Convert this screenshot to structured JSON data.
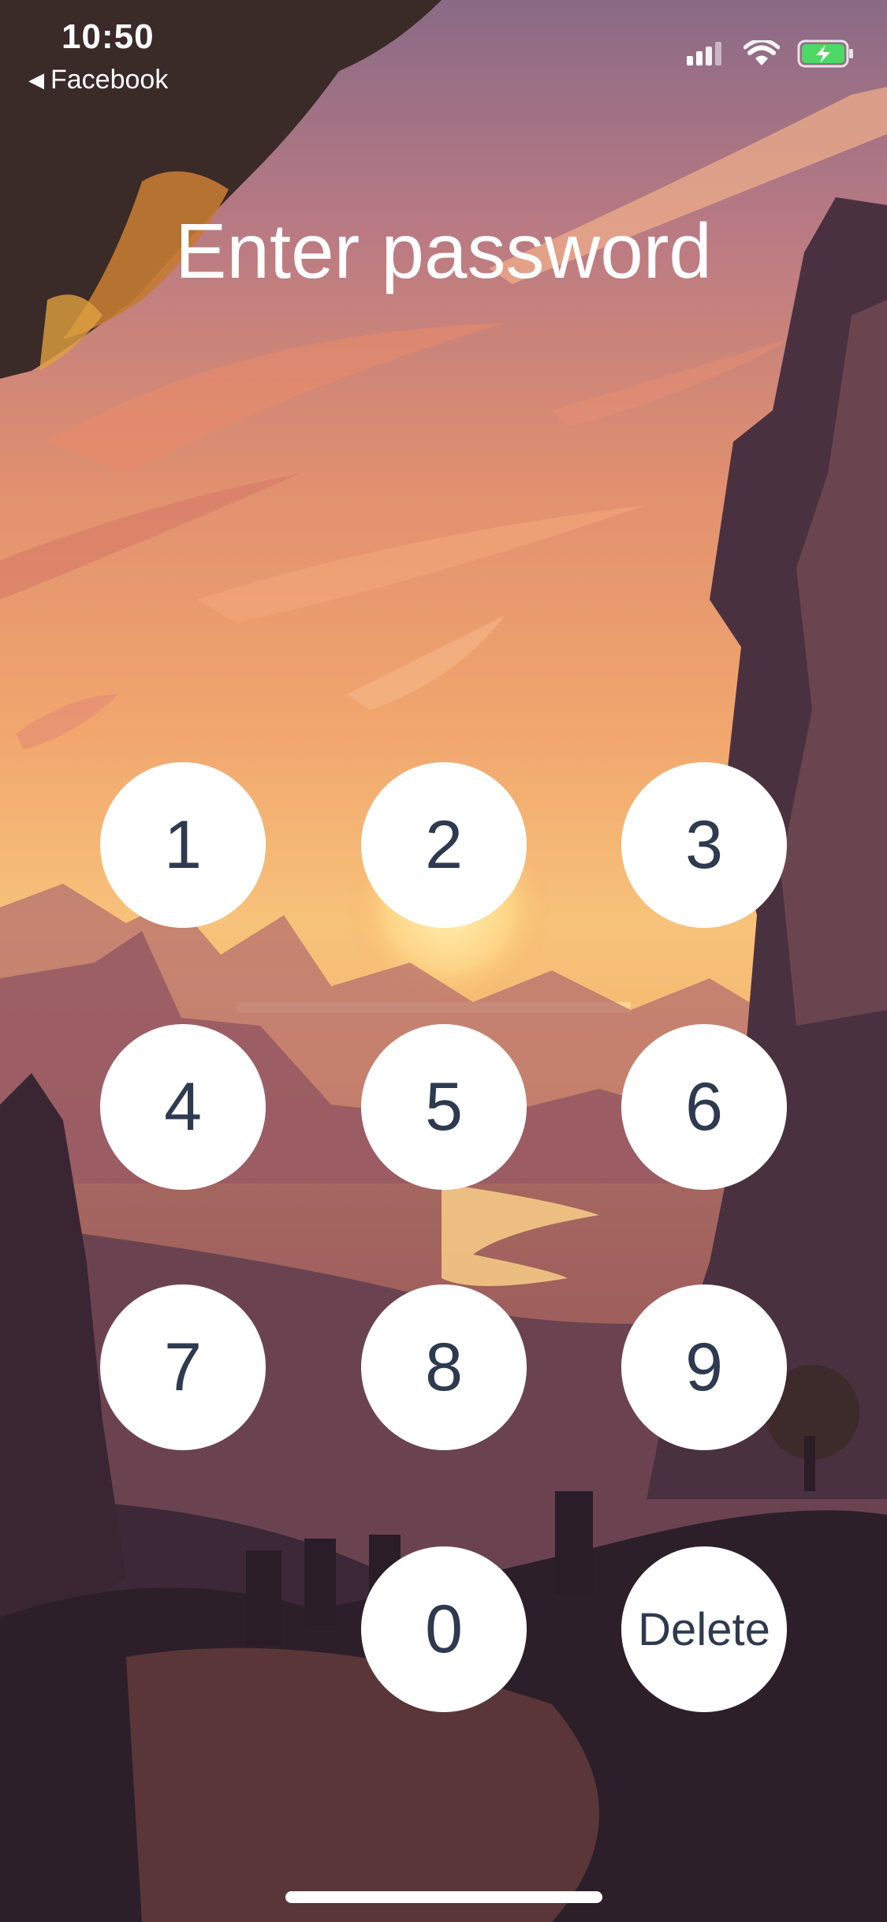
{
  "status_bar": {
    "time": "10:50",
    "back_label": "Facebook",
    "icons": [
      "cellular-signal-icon",
      "wifi-icon",
      "battery-charging-icon"
    ],
    "battery_color": "#4cd964"
  },
  "title": "Enter password",
  "keypad": {
    "keys": [
      "1",
      "2",
      "3",
      "4",
      "5",
      "6",
      "7",
      "8",
      "9",
      "0",
      "Delete"
    ],
    "key_bg": "#ffffff",
    "key_text_color": "#2e3a4f"
  },
  "background": "sunset-landscape-illustration"
}
